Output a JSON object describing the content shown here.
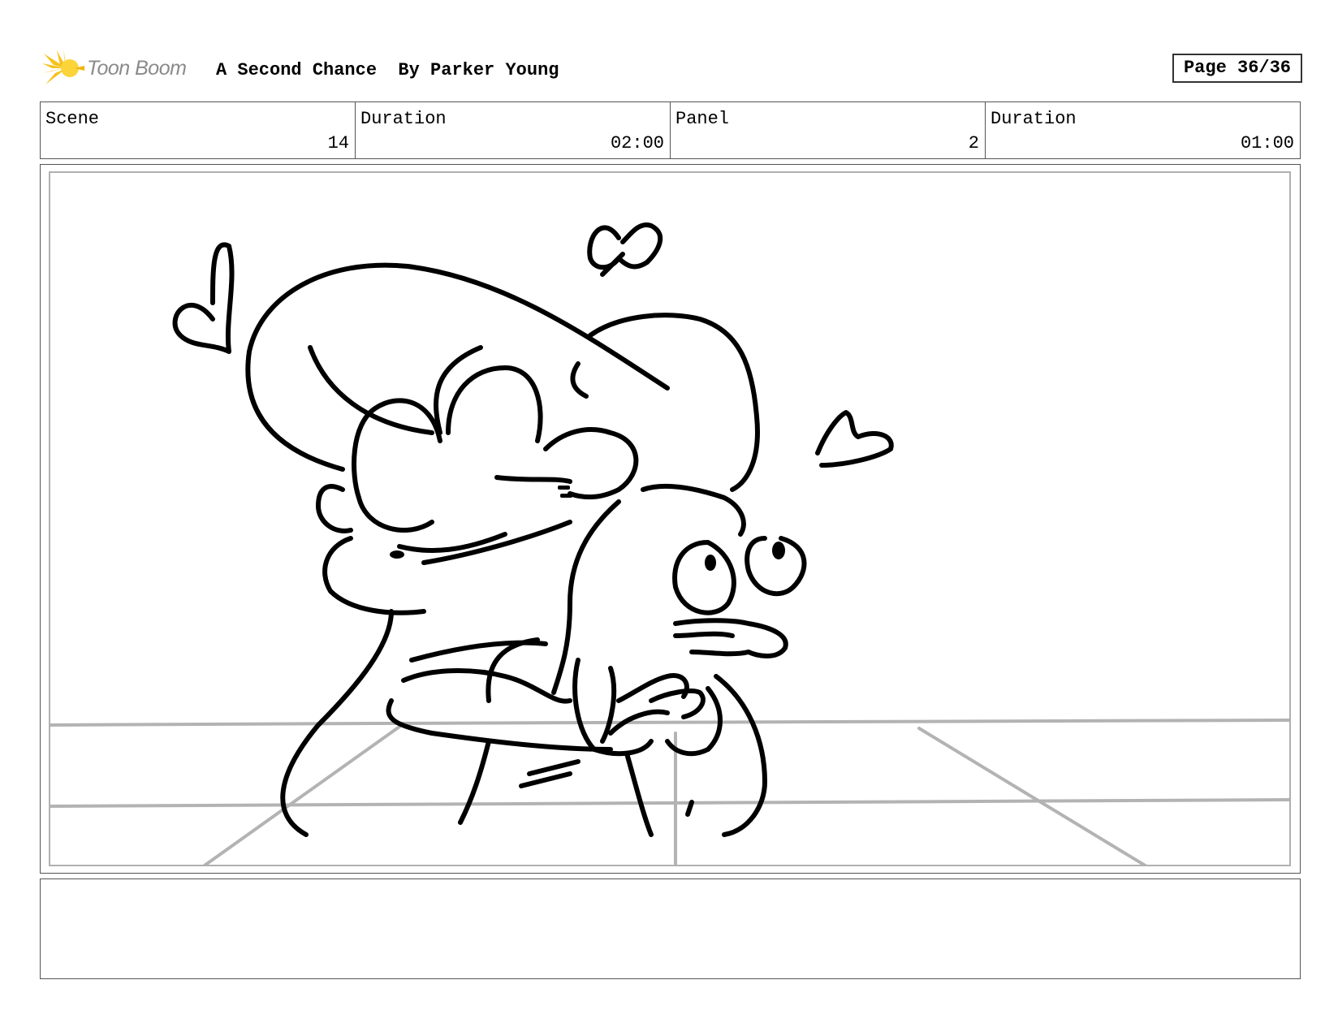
{
  "header": {
    "logo_text": "Toon Boom",
    "title": "A Second Chance  By Parker Young",
    "page": "Page 36/36"
  },
  "info": {
    "scene_label": "Scene",
    "scene_value": "14",
    "scene_duration_label": "Duration",
    "scene_duration_value": "02:00",
    "panel_label": "Panel",
    "panel_value": "2",
    "panel_duration_label": "Duration",
    "panel_duration_value": "01:00"
  },
  "notes": {
    "text": ""
  }
}
